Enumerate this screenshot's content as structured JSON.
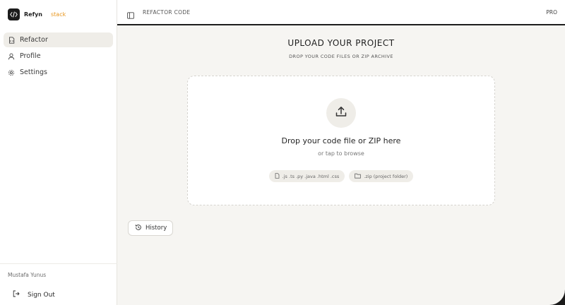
{
  "brand": {
    "name": "Refyn",
    "tag": "stack",
    "tag_color": "#e8961e"
  },
  "sidebar": {
    "items": [
      {
        "label": "Refactor",
        "icon": "file-code-icon",
        "active": true
      },
      {
        "label": "Profile",
        "icon": "user-icon",
        "active": false
      },
      {
        "label": "Settings",
        "icon": "gear-icon",
        "active": false
      }
    ],
    "user_name": "Mustafa Yunus",
    "signout_label": "Sign Out"
  },
  "topbar": {
    "title": "REFACTOR CODE",
    "plan": "PRO"
  },
  "main": {
    "heading": "UPLOAD YOUR PROJECT",
    "subheading": "DROP YOUR CODE FILES OR ZIP ARCHIVE",
    "dropzone": {
      "title": "Drop your code file or ZIP here",
      "subtitle": "or tap to browse",
      "chips": [
        {
          "label": ".js .ts .py .java .html .css",
          "icon": "file-icon"
        },
        {
          "label": ".zip (project folder)",
          "icon": "folder-icon"
        }
      ]
    },
    "history_label": "History"
  }
}
